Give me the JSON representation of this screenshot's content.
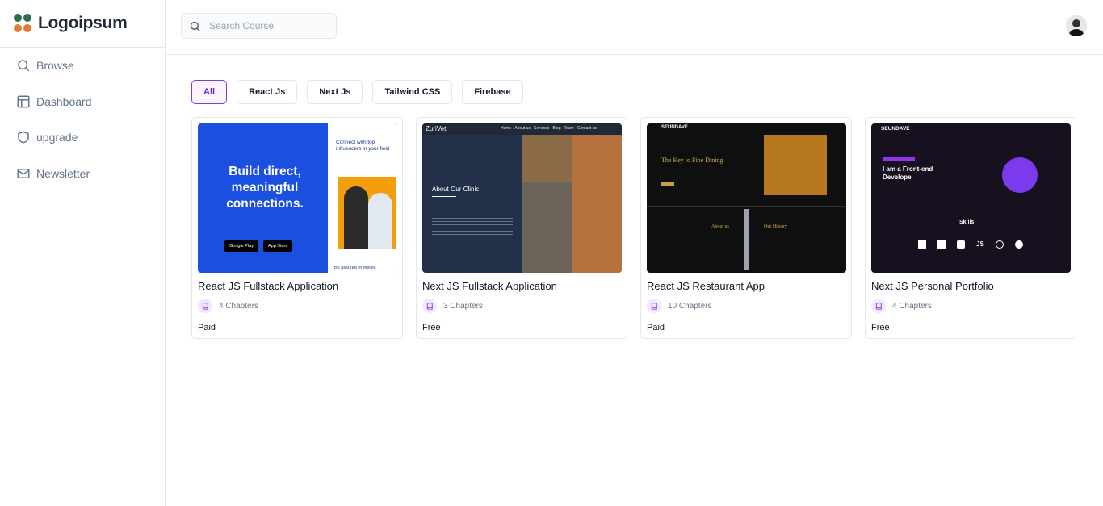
{
  "brand": {
    "name": "Logoipsum"
  },
  "sidebar": {
    "items": [
      {
        "label": "Browse",
        "icon": "search-icon"
      },
      {
        "label": "Dashboard",
        "icon": "layout-icon"
      },
      {
        "label": "upgrade",
        "icon": "shield-icon"
      },
      {
        "label": "Newsletter",
        "icon": "mail-icon"
      }
    ]
  },
  "search": {
    "placeholder": "Search Course"
  },
  "filters": [
    {
      "label": "All",
      "active": true
    },
    {
      "label": "React Js"
    },
    {
      "label": "Next Js"
    },
    {
      "label": "Tailwind CSS"
    },
    {
      "label": "Firebase"
    }
  ],
  "courses": [
    {
      "title": "React JS Fullstack Application",
      "chapters": "4 Chapters",
      "price": "Paid",
      "thumb": {
        "headline_l1": "Build direct,",
        "headline_l2": "meaningful",
        "headline_l3": "connections.",
        "side_text": "Connect with top influencers in your field",
        "btn1": "Google Play",
        "btn2": "App Store",
        "footer": "Be assured of replies"
      }
    },
    {
      "title": "Next JS Fullstack Application",
      "chapters": "3 Chapters",
      "price": "Free",
      "thumb": {
        "brand": "ZuriVet",
        "heading": "About Our Clinic",
        "nav": "Home   About us   Services   Blog   Team   Contact us"
      }
    },
    {
      "title": "React JS Restaurant App",
      "chapters": "10 Chapters",
      "price": "Paid",
      "thumb": {
        "brand": "SEUNDAVE",
        "heading": "The Key to Fine Dining",
        "about": "About us",
        "history": "Our History"
      }
    },
    {
      "title": "Next JS Personal Portfolio",
      "chapters": "4 Chapters",
      "price": "Free",
      "thumb": {
        "brand": "SEUNDAVE",
        "heading_l1": "I am a Front-end",
        "heading_l2": "Develope",
        "skills": "Skills",
        "js": "JS"
      }
    }
  ]
}
